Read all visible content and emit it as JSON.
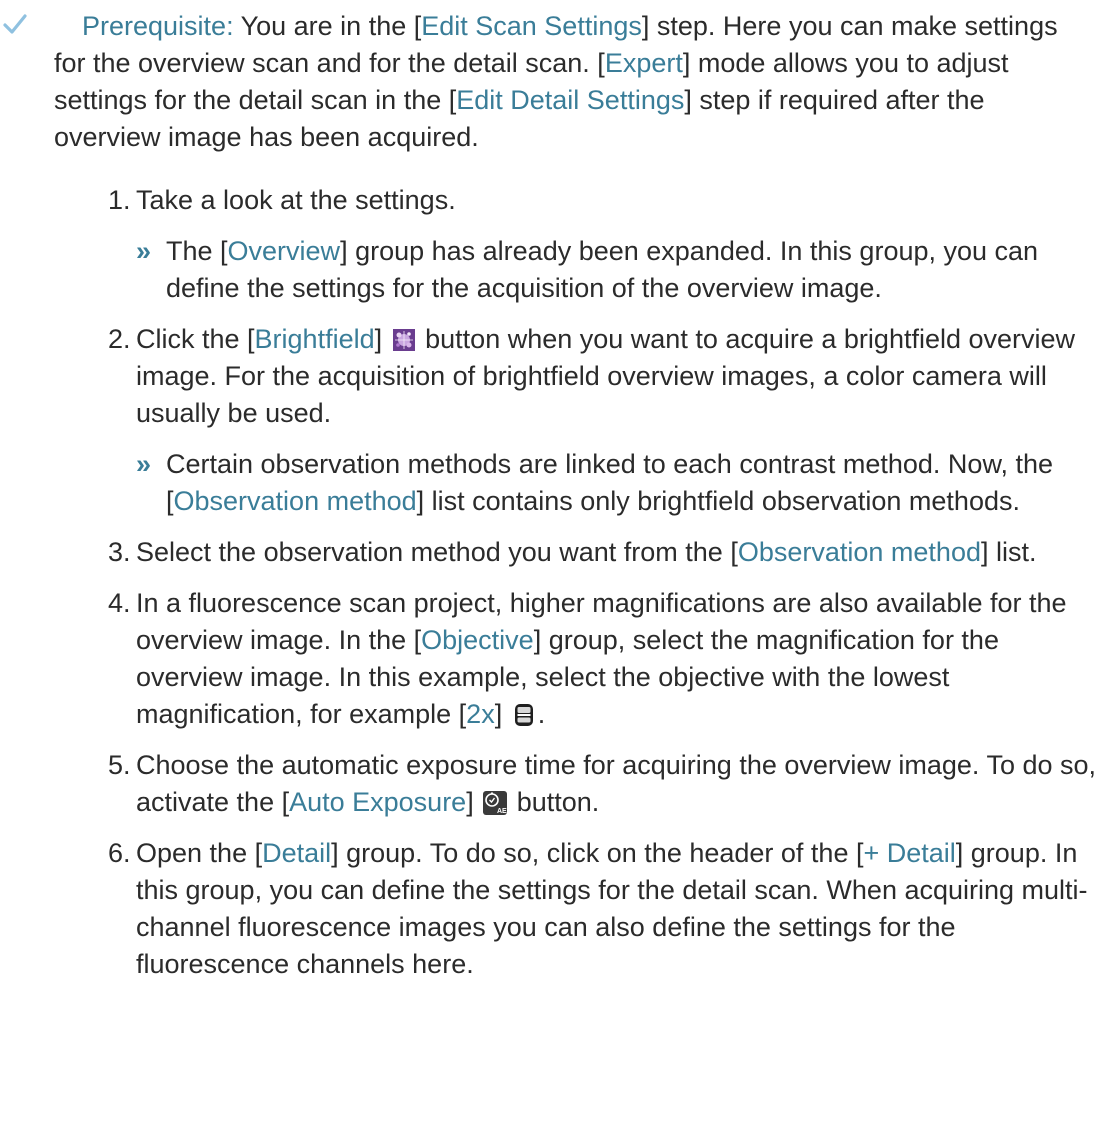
{
  "prerequisite": {
    "label": "Prerequisite:",
    "t1": " You are in the [",
    "l1": "Edit Scan Settings",
    "t2": "] step. Here you can make settings for the overview scan and for the detail scan. [",
    "l2": "Expert",
    "t3": "] mode allows you to adjust settings for the detail scan in the [",
    "l3": "Edit Detail Settings",
    "t4": "] step if required after the overview image has been acquired."
  },
  "steps": [
    {
      "num": "1.",
      "parts": [
        "Take a look at the settings."
      ],
      "result": {
        "arrow": "»",
        "t1": "The [",
        "l1": "Overview",
        "t2": "] group has already been expanded. In this group, you can define the settings for the acquisition of the overview image."
      }
    },
    {
      "num": "2.",
      "t1": "Click the [",
      "l1": "Brightfield",
      "t2": "] ",
      "icon": "brightfield-icon",
      "t3": " button when you want to acquire a brightfield overview image. For the acquisition of brightfield overview images, a color camera will usually be used.",
      "result": {
        "arrow": "»",
        "t1": "Certain observation methods are linked to each contrast method. Now, the [",
        "l1": "Observation method",
        "t2": "] list contains only brightfield observation methods."
      }
    },
    {
      "num": "3.",
      "t1": "Select the observation method you want from the [",
      "l1": "Observation method",
      "t2": "] list."
    },
    {
      "num": "4.",
      "t1": "In a fluorescence scan project, higher magnifications are also available for the overview image. In the [",
      "l1": "Objective",
      "t2": "] group, select the magnification for the overview image. In this example, select the objective with the lowest magnification, for example [",
      "l2": "2x",
      "t3": "] ",
      "icon": "objective-icon",
      "t4": "."
    },
    {
      "num": "5.",
      "t1": "Choose the automatic exposure time for acquiring the overview image. To do so, activate the [",
      "l1": "Auto Exposure",
      "t2": "] ",
      "icon": "auto-exposure-icon",
      "t3": " button."
    },
    {
      "num": "6.",
      "t1": "Open the [",
      "l1": "Detail",
      "t2": "] group. To do so, click on the header of the [",
      "l2": "+ Detail",
      "t3": "] group. In this group, you can define the settings for the detail scan. When acquiring multi-channel fluorescence images you can also define the settings for the fluorescence channels here."
    }
  ],
  "colors": {
    "text": "#2b2b2b",
    "link": "#3a7d98",
    "check": "#8fc1e0"
  }
}
